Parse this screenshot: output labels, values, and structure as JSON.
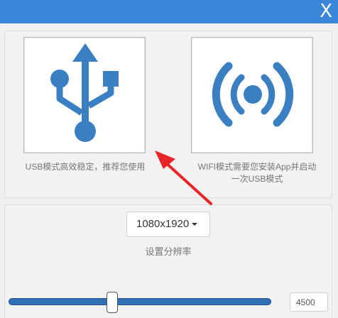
{
  "titlebar": {
    "close_label": "X",
    "color": "#3a86d8"
  },
  "modes": {
    "usb": {
      "icon": "usb-icon",
      "caption": "USB模式高效稳定，推荐您使用"
    },
    "wifi": {
      "icon": "wifi-broadcast-icon",
      "caption_line1": "WIFI模式需要您安装App并启动",
      "caption_line2": "一次USB模式"
    }
  },
  "resolution": {
    "selected": "1080x1920",
    "label": "设置分辨率"
  },
  "bitrate": {
    "value": "4500"
  },
  "colors": {
    "icon_blue": "#3a7fc1",
    "arrow_red": "#e8262a",
    "slider_blue": "#2f6fb5"
  }
}
